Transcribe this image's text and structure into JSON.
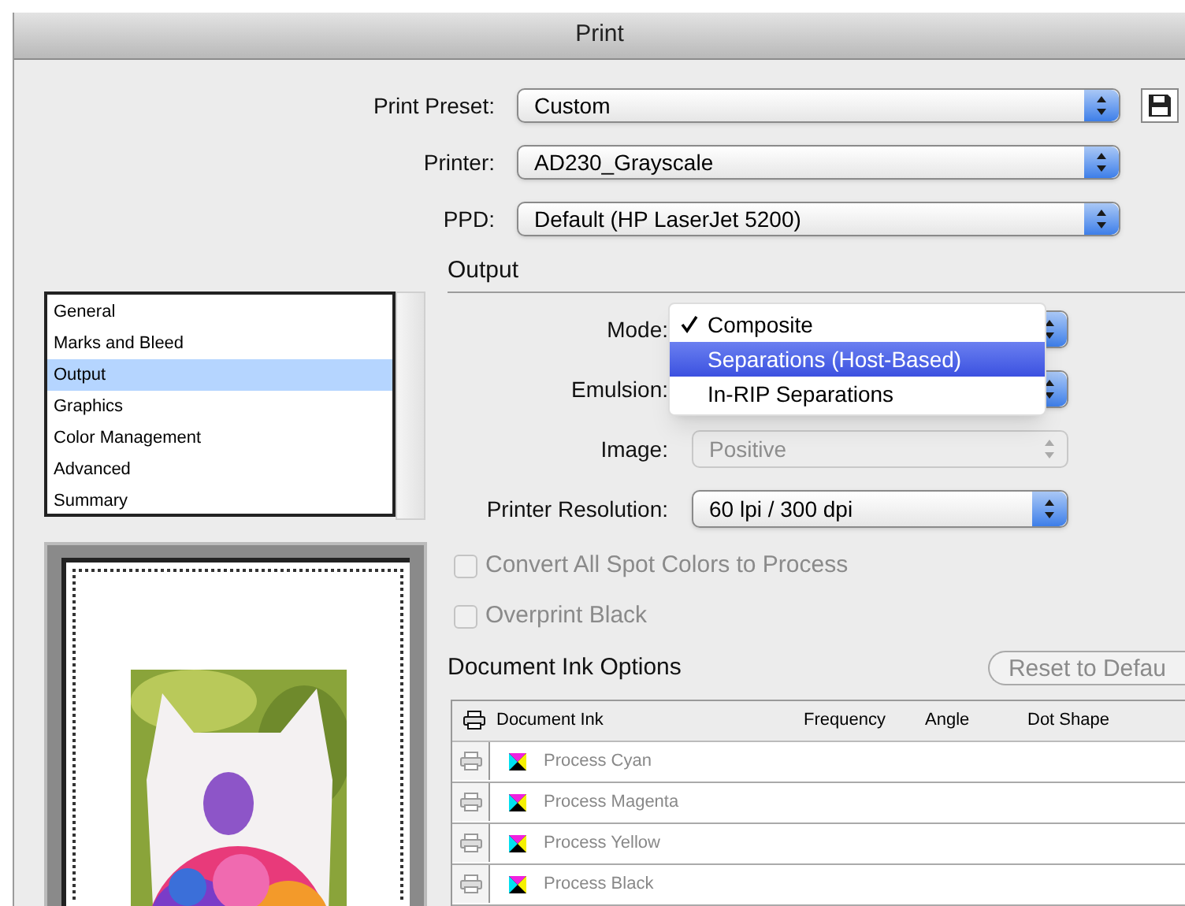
{
  "window": {
    "title": "Print"
  },
  "top_fields": [
    {
      "label": "Print Preset:",
      "value": "Custom",
      "save_button": true
    },
    {
      "label": "Printer:",
      "value": "AD230_Grayscale",
      "save_button": false
    },
    {
      "label": "PPD:",
      "value": "Default (HP LaserJet 5200)",
      "save_button": false
    }
  ],
  "sidebar": {
    "items": [
      {
        "label": "General",
        "selected": false
      },
      {
        "label": "Marks and Bleed",
        "selected": false
      },
      {
        "label": "Output",
        "selected": true
      },
      {
        "label": "Graphics",
        "selected": false
      },
      {
        "label": "Color Management",
        "selected": false
      },
      {
        "label": "Advanced",
        "selected": false
      },
      {
        "label": "Summary",
        "selected": false
      }
    ]
  },
  "output": {
    "title": "Output",
    "mode": {
      "label": "Mode:",
      "menu": [
        {
          "label": "Composite",
          "checked": true,
          "highlighted": false
        },
        {
          "label": "Separations (Host-Based)",
          "checked": false,
          "highlighted": true
        },
        {
          "label": "In-RIP Separations",
          "checked": false,
          "highlighted": false
        }
      ]
    },
    "emulsion": {
      "label": "Emulsion:"
    },
    "image": {
      "label": "Image:",
      "value": "Positive",
      "disabled": true
    },
    "resolution": {
      "label": "Printer Resolution:",
      "value": "60 lpi / 300 dpi",
      "disabled": false
    },
    "checkboxes": [
      {
        "label": "Convert All Spot Colors to Process",
        "checked": false,
        "disabled": true
      },
      {
        "label": "Overprint Black",
        "checked": false,
        "disabled": true
      }
    ]
  },
  "ink_options": {
    "title": "Document Ink Options",
    "reset_button": "Reset to Defau",
    "columns": [
      "Document Ink",
      "Frequency",
      "Angle",
      "Dot Shape"
    ],
    "rows": [
      {
        "name": "Process Cyan"
      },
      {
        "name": "Process Magenta"
      },
      {
        "name": "Process Yellow"
      },
      {
        "name": "Process Black"
      }
    ]
  }
}
